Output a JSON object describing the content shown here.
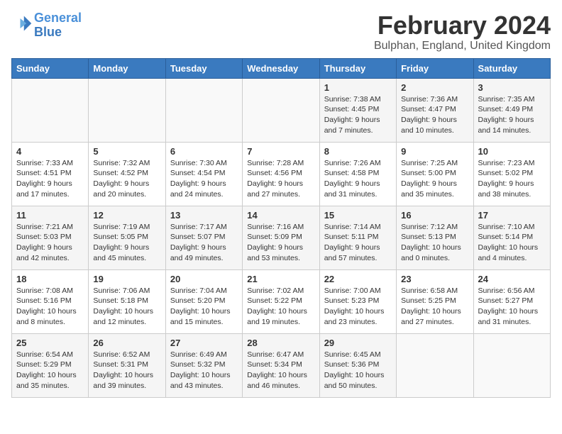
{
  "header": {
    "logo_line1": "General",
    "logo_line2": "Blue",
    "month": "February 2024",
    "location": "Bulphan, England, United Kingdom"
  },
  "columns": [
    "Sunday",
    "Monday",
    "Tuesday",
    "Wednesday",
    "Thursday",
    "Friday",
    "Saturday"
  ],
  "weeks": [
    [
      {
        "day": "",
        "detail": ""
      },
      {
        "day": "",
        "detail": ""
      },
      {
        "day": "",
        "detail": ""
      },
      {
        "day": "",
        "detail": ""
      },
      {
        "day": "1",
        "detail": "Sunrise: 7:38 AM\nSunset: 4:45 PM\nDaylight: 9 hours\nand 7 minutes."
      },
      {
        "day": "2",
        "detail": "Sunrise: 7:36 AM\nSunset: 4:47 PM\nDaylight: 9 hours\nand 10 minutes."
      },
      {
        "day": "3",
        "detail": "Sunrise: 7:35 AM\nSunset: 4:49 PM\nDaylight: 9 hours\nand 14 minutes."
      }
    ],
    [
      {
        "day": "4",
        "detail": "Sunrise: 7:33 AM\nSunset: 4:51 PM\nDaylight: 9 hours\nand 17 minutes."
      },
      {
        "day": "5",
        "detail": "Sunrise: 7:32 AM\nSunset: 4:52 PM\nDaylight: 9 hours\nand 20 minutes."
      },
      {
        "day": "6",
        "detail": "Sunrise: 7:30 AM\nSunset: 4:54 PM\nDaylight: 9 hours\nand 24 minutes."
      },
      {
        "day": "7",
        "detail": "Sunrise: 7:28 AM\nSunset: 4:56 PM\nDaylight: 9 hours\nand 27 minutes."
      },
      {
        "day": "8",
        "detail": "Sunrise: 7:26 AM\nSunset: 4:58 PM\nDaylight: 9 hours\nand 31 minutes."
      },
      {
        "day": "9",
        "detail": "Sunrise: 7:25 AM\nSunset: 5:00 PM\nDaylight: 9 hours\nand 35 minutes."
      },
      {
        "day": "10",
        "detail": "Sunrise: 7:23 AM\nSunset: 5:02 PM\nDaylight: 9 hours\nand 38 minutes."
      }
    ],
    [
      {
        "day": "11",
        "detail": "Sunrise: 7:21 AM\nSunset: 5:03 PM\nDaylight: 9 hours\nand 42 minutes."
      },
      {
        "day": "12",
        "detail": "Sunrise: 7:19 AM\nSunset: 5:05 PM\nDaylight: 9 hours\nand 45 minutes."
      },
      {
        "day": "13",
        "detail": "Sunrise: 7:17 AM\nSunset: 5:07 PM\nDaylight: 9 hours\nand 49 minutes."
      },
      {
        "day": "14",
        "detail": "Sunrise: 7:16 AM\nSunset: 5:09 PM\nDaylight: 9 hours\nand 53 minutes."
      },
      {
        "day": "15",
        "detail": "Sunrise: 7:14 AM\nSunset: 5:11 PM\nDaylight: 9 hours\nand 57 minutes."
      },
      {
        "day": "16",
        "detail": "Sunrise: 7:12 AM\nSunset: 5:13 PM\nDaylight: 10 hours\nand 0 minutes."
      },
      {
        "day": "17",
        "detail": "Sunrise: 7:10 AM\nSunset: 5:14 PM\nDaylight: 10 hours\nand 4 minutes."
      }
    ],
    [
      {
        "day": "18",
        "detail": "Sunrise: 7:08 AM\nSunset: 5:16 PM\nDaylight: 10 hours\nand 8 minutes."
      },
      {
        "day": "19",
        "detail": "Sunrise: 7:06 AM\nSunset: 5:18 PM\nDaylight: 10 hours\nand 12 minutes."
      },
      {
        "day": "20",
        "detail": "Sunrise: 7:04 AM\nSunset: 5:20 PM\nDaylight: 10 hours\nand 15 minutes."
      },
      {
        "day": "21",
        "detail": "Sunrise: 7:02 AM\nSunset: 5:22 PM\nDaylight: 10 hours\nand 19 minutes."
      },
      {
        "day": "22",
        "detail": "Sunrise: 7:00 AM\nSunset: 5:23 PM\nDaylight: 10 hours\nand 23 minutes."
      },
      {
        "day": "23",
        "detail": "Sunrise: 6:58 AM\nSunset: 5:25 PM\nDaylight: 10 hours\nand 27 minutes."
      },
      {
        "day": "24",
        "detail": "Sunrise: 6:56 AM\nSunset: 5:27 PM\nDaylight: 10 hours\nand 31 minutes."
      }
    ],
    [
      {
        "day": "25",
        "detail": "Sunrise: 6:54 AM\nSunset: 5:29 PM\nDaylight: 10 hours\nand 35 minutes."
      },
      {
        "day": "26",
        "detail": "Sunrise: 6:52 AM\nSunset: 5:31 PM\nDaylight: 10 hours\nand 39 minutes."
      },
      {
        "day": "27",
        "detail": "Sunrise: 6:49 AM\nSunset: 5:32 PM\nDaylight: 10 hours\nand 43 minutes."
      },
      {
        "day": "28",
        "detail": "Sunrise: 6:47 AM\nSunset: 5:34 PM\nDaylight: 10 hours\nand 46 minutes."
      },
      {
        "day": "29",
        "detail": "Sunrise: 6:45 AM\nSunset: 5:36 PM\nDaylight: 10 hours\nand 50 minutes."
      },
      {
        "day": "",
        "detail": ""
      },
      {
        "day": "",
        "detail": ""
      }
    ]
  ]
}
